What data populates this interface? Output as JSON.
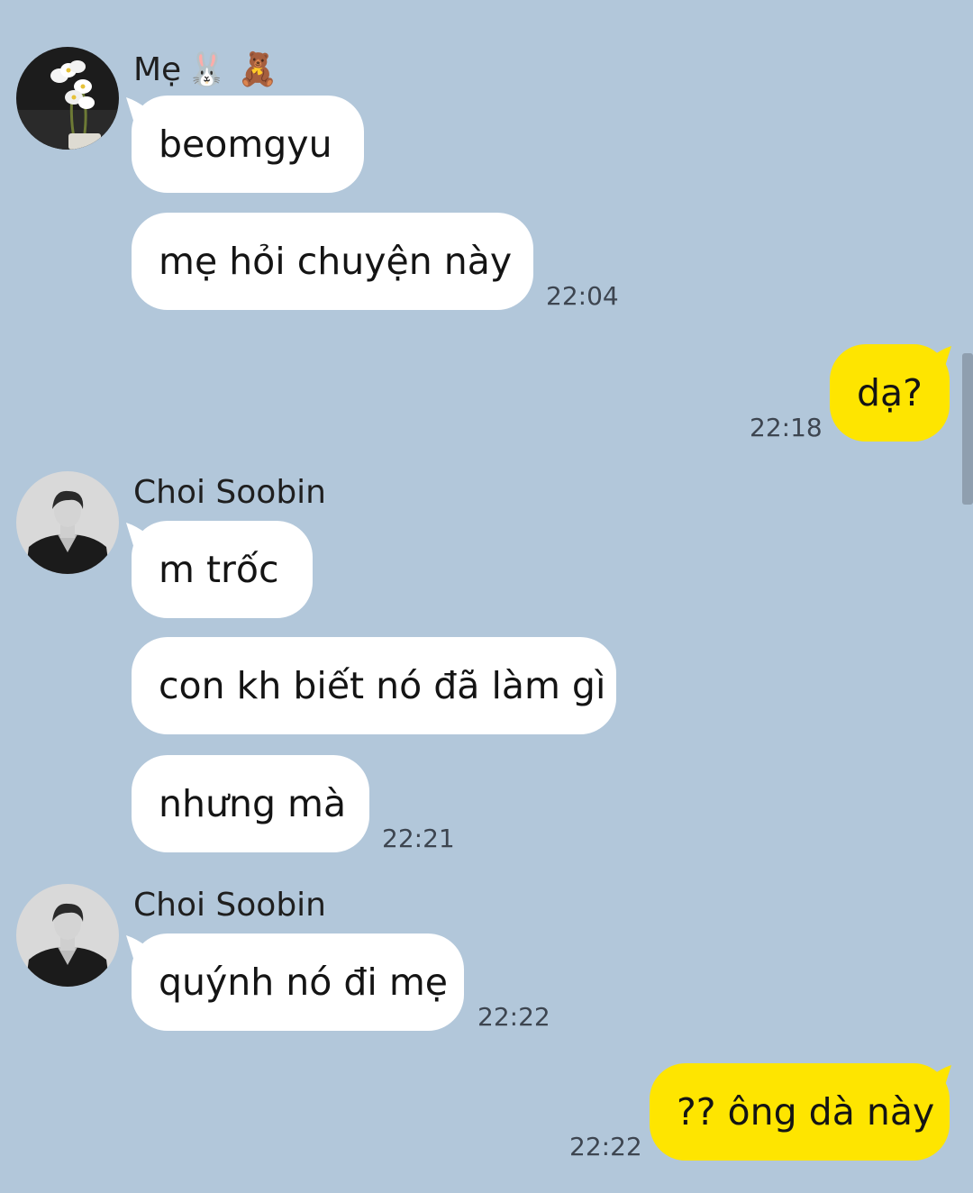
{
  "chat": {
    "colors": {
      "background": "#b2c7da",
      "incoming_bubble": "#ffffff",
      "outgoing_bubble": "#fee500"
    },
    "groups": [
      {
        "sender": "Mẹ",
        "sender_emojis": "🐰 🧸",
        "avatar_icon": "flower-avatar-icon",
        "messages": [
          "beomgyu",
          "mẹ hỏi chuyện này"
        ],
        "time": "22:04"
      },
      {
        "sender": "me",
        "messages": [
          "dạ?"
        ],
        "time": "22:18"
      },
      {
        "sender": "Choi Soobin",
        "avatar_icon": "person-avatar-icon",
        "messages": [
          "m trốc",
          "con kh biết nó đã làm gì",
          "nhưng mà"
        ],
        "time": "22:21"
      },
      {
        "sender": "Choi Soobin",
        "avatar_icon": "person-avatar-icon",
        "messages": [
          "quýnh nó đi mẹ"
        ],
        "time": "22:22"
      },
      {
        "sender": "me",
        "messages": [
          "?? ông dà này"
        ],
        "time": "22:22"
      }
    ]
  }
}
